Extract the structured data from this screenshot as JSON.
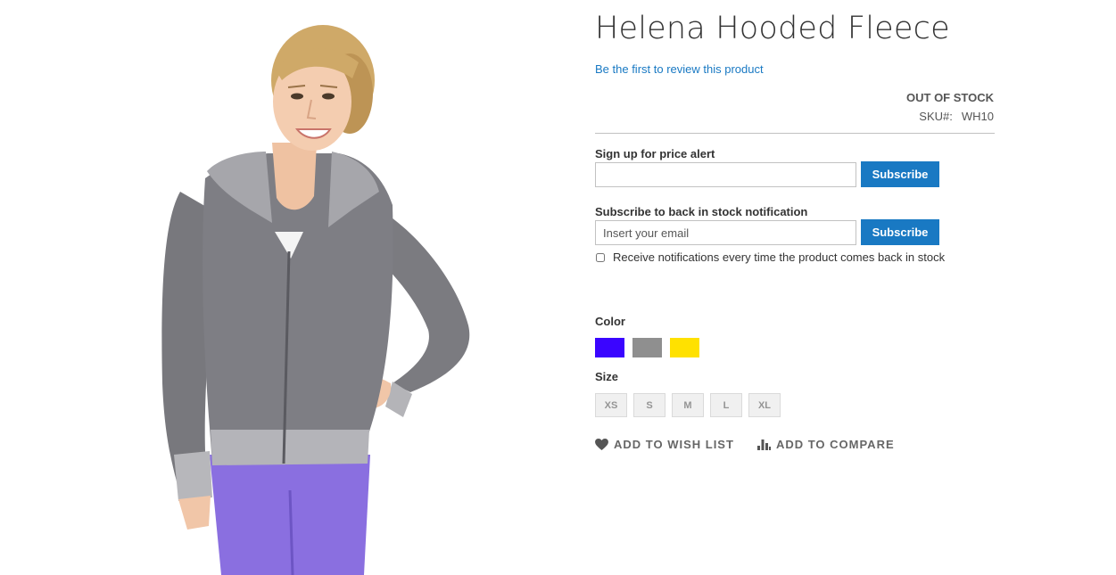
{
  "product": {
    "title": "Helena Hooded Fleece",
    "review_link": "Be the first to review this product",
    "stock_status": "OUT OF STOCK",
    "sku_label": "SKU#:",
    "sku_value": "WH10",
    "image_icon": "product-photo-woman-in-grey-hooded-fleece"
  },
  "price_alert": {
    "label": "Sign up for price alert",
    "input_value": "",
    "input_placeholder": "",
    "button_label": "Subscribe"
  },
  "stock_alert": {
    "label": "Subscribe to back in stock notification",
    "input_value": "",
    "input_placeholder": "Insert your email",
    "button_label": "Subscribe",
    "checkbox_label": "Receive notifications every time the product comes back in stock",
    "checkbox_checked": false
  },
  "options": {
    "color_label": "Color",
    "colors": [
      {
        "name": "Blue",
        "hex": "#3a05ff"
      },
      {
        "name": "Gray",
        "hex": "#8f8f8f"
      },
      {
        "name": "Yellow",
        "hex": "#ffe100"
      }
    ],
    "size_label": "Size",
    "sizes": [
      "XS",
      "S",
      "M",
      "L",
      "XL"
    ]
  },
  "actions": {
    "wishlist_label": "Add to Wish List",
    "wishlist_icon": "heart-icon",
    "compare_label": "Add to Compare",
    "compare_icon": "bar-chart-icon"
  },
  "colors": {
    "link": "#1979c3",
    "button_bg": "#1979c3",
    "text": "#333333",
    "muted": "#666666"
  }
}
